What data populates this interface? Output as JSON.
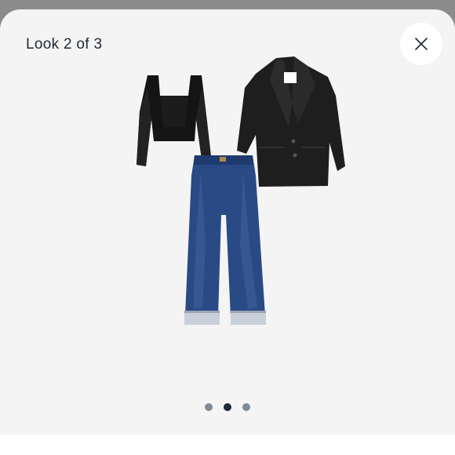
{
  "modal": {
    "title": "Look 2 of 3"
  },
  "icons": {
    "close": "close-icon"
  },
  "outfit": {
    "items": [
      {
        "name": "square-neck-top",
        "color": "#141414"
      },
      {
        "name": "blazer",
        "color": "#1e1e1e"
      },
      {
        "name": "wide-leg-jeans",
        "color": "#2a4a86"
      }
    ]
  },
  "carousel": {
    "total": 3,
    "active_index": 1
  },
  "colors": {
    "dot_inactive": "#7e8a97",
    "dot_active": "#1f2a37",
    "modal_bg": "#f4f4f4"
  }
}
